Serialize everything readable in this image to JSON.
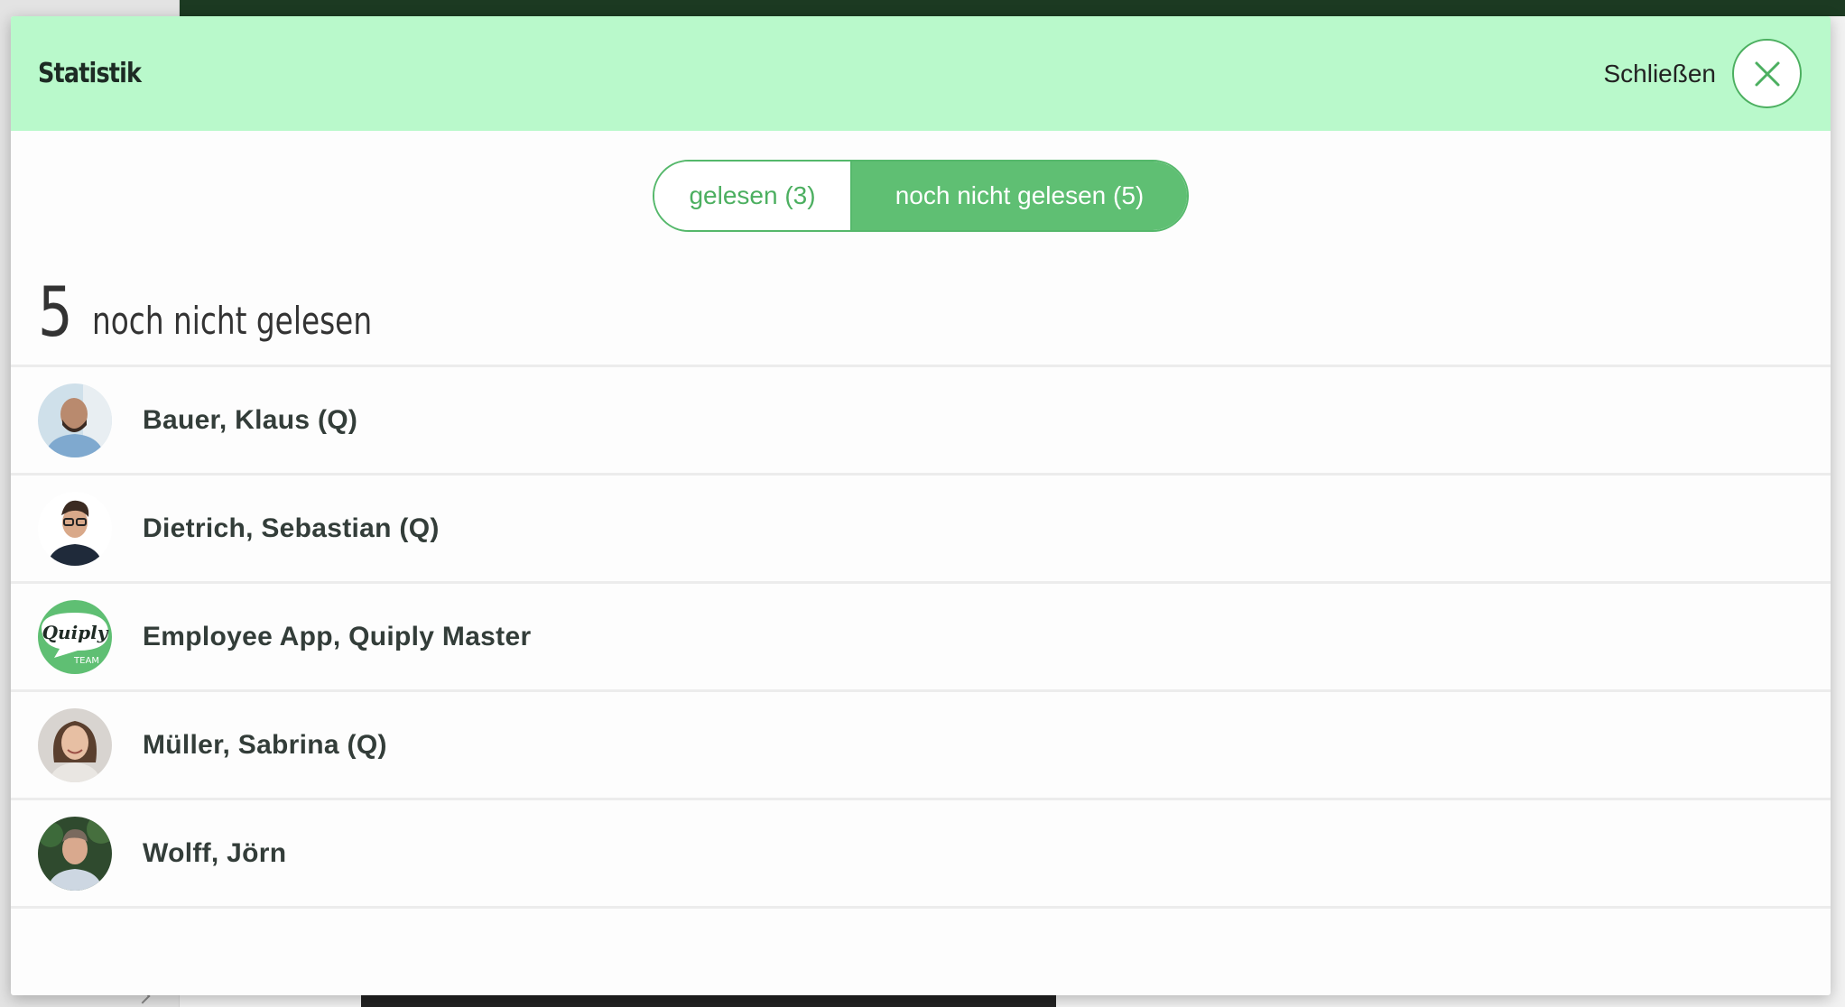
{
  "modal": {
    "title": "Statistik",
    "close_label": "Schließen"
  },
  "toggle": {
    "read_label": "gelesen (3)",
    "unread_label": "noch nicht gelesen (5)",
    "active": "unread"
  },
  "summary": {
    "count": "5",
    "label": "noch nicht gelesen"
  },
  "users": [
    {
      "name": "Bauer, Klaus (Q)",
      "avatar": "photo-man-bald-beard"
    },
    {
      "name": "Dietrich, Sebastian (Q)",
      "avatar": "photo-man-glasses"
    },
    {
      "name": "Employee App, Quiply Master",
      "avatar": "quiply-team-logo"
    },
    {
      "name": "Müller, Sabrina (Q)",
      "avatar": "photo-woman"
    },
    {
      "name": "Wolff, Jörn",
      "avatar": "photo-man-outdoor"
    }
  ],
  "colors": {
    "header_bg": "#b9f9cb",
    "accent_green": "#5fbf73",
    "text_dark": "#333d39"
  }
}
